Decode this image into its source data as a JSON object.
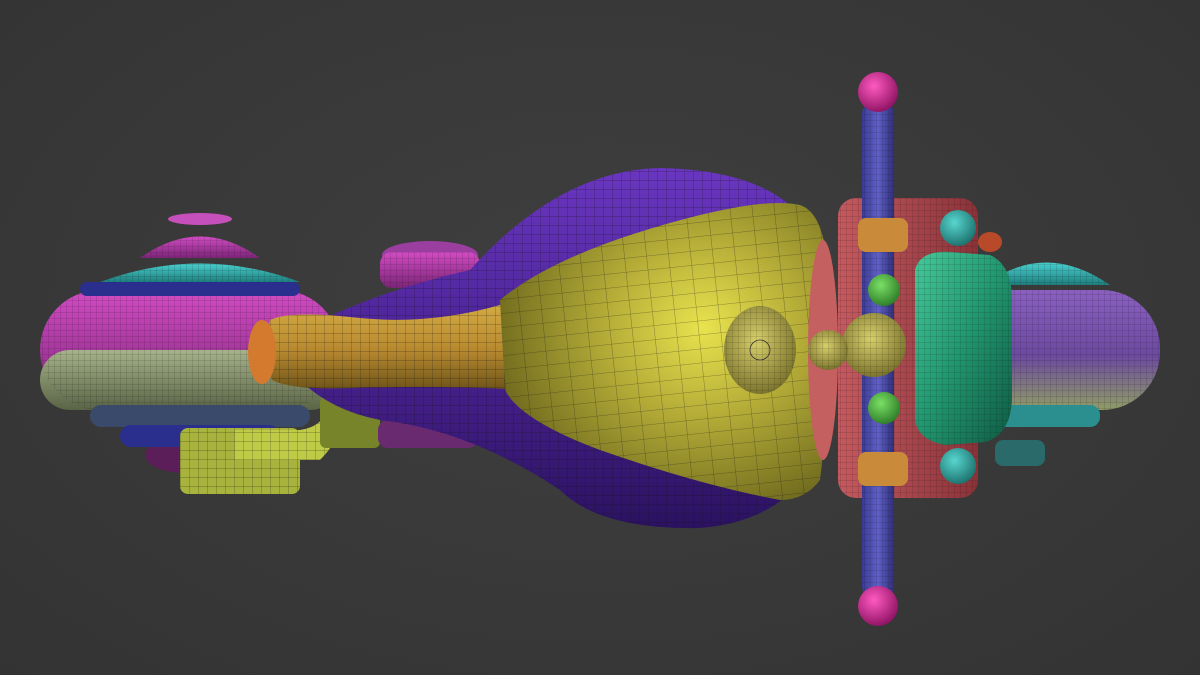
{
  "scene": {
    "subject": "",
    "background_color": "#393939",
    "wireframe_color": "#141414",
    "palette": {
      "magenta": "#b03aa6",
      "magenta_dark": "#6e1f6a",
      "cyan": "#2fb7b6",
      "navy": "#2b2f8a",
      "sage": "#8e9a72",
      "purple": "#5a2ba6",
      "purple_dark": "#35186a",
      "yellow": "#b8b038",
      "yellow_bright": "#d9d64a",
      "yellow_dark": "#7d7722",
      "orange": "#c98a3a",
      "green_bright": "#58c24a",
      "teal": "#2a9e7a",
      "red": "#b84a52",
      "pink": "#d22a8f",
      "blue": "#4a4aa8",
      "olive": "#8e9b3c"
    }
  }
}
